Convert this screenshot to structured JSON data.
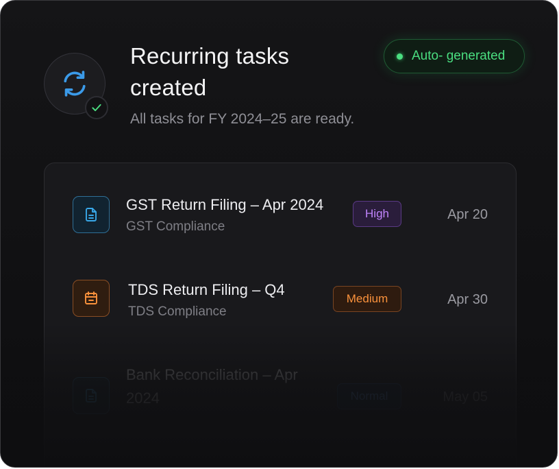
{
  "header": {
    "title": "Recurring tasks created",
    "subtitle": "All tasks for FY 2024–25 are ready.",
    "badge_label": "Auto- generated"
  },
  "tasks": [
    {
      "title": "GST Return Filing – Apr 2024",
      "category": "GST Compliance",
      "priority": "High",
      "date": "Apr 20",
      "icon": "document-icon"
    },
    {
      "title": "TDS Return Filing – Q4",
      "category": "TDS Compliance",
      "priority": "Medium",
      "date": "Apr 30",
      "icon": "calendar-icon"
    },
    {
      "title_line1": "Bank Reconciliation – Apr",
      "title_line2": "2024",
      "priority": "Normal",
      "date": "May 05",
      "icon": "document-icon"
    }
  ],
  "colors": {
    "accent_blue": "#3b9ae8",
    "success_green": "#4ade80",
    "priority_high": "#c084fc",
    "priority_medium": "#fb923c",
    "priority_normal": "#60a5fa"
  }
}
